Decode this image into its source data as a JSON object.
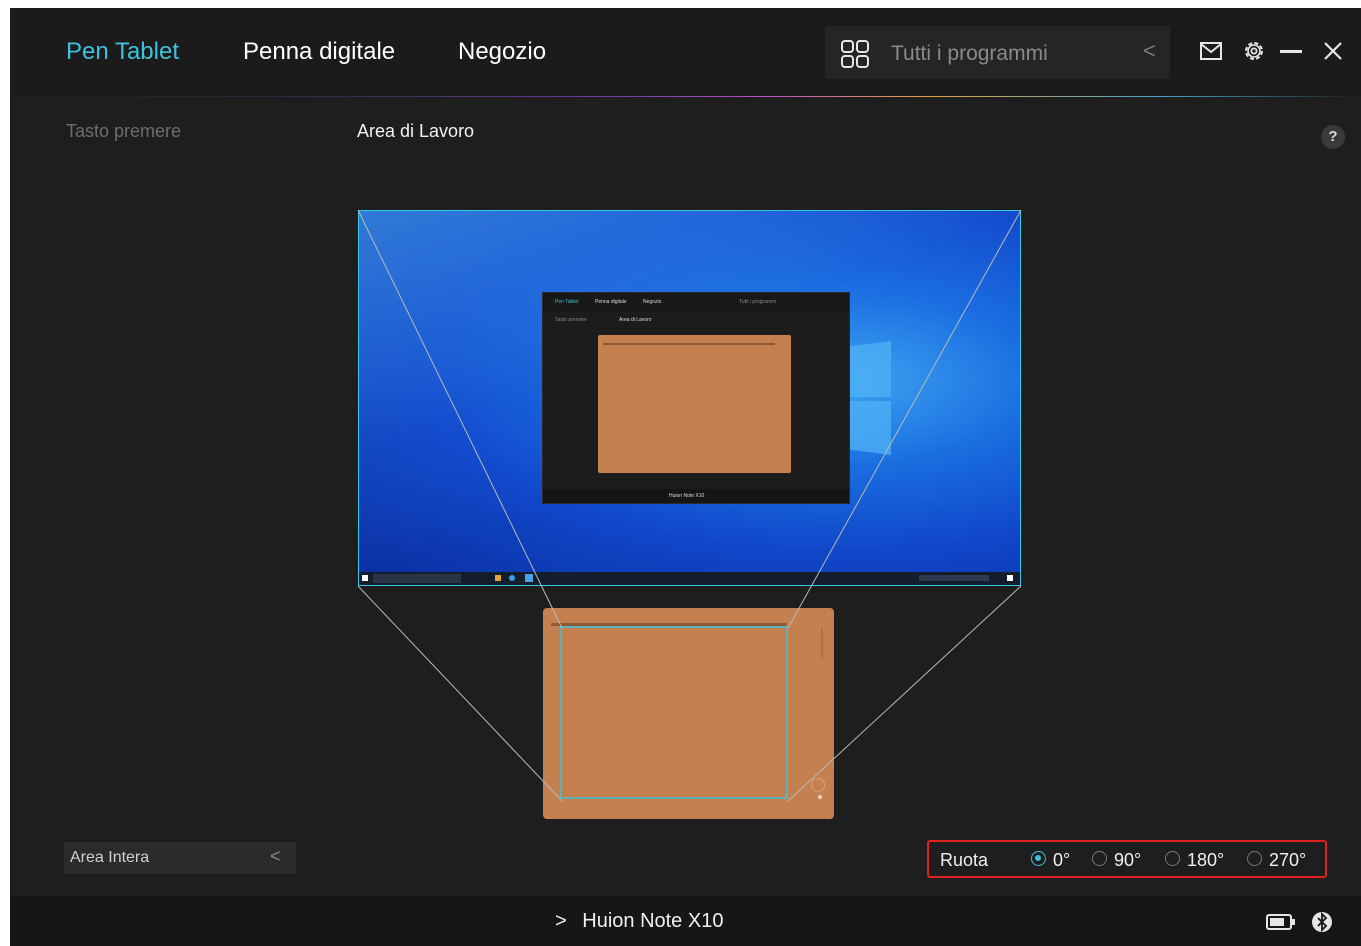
{
  "nav": {
    "tabs": [
      {
        "label": "Pen Tablet",
        "active": true
      },
      {
        "label": "Penna digitale",
        "active": false
      },
      {
        "label": "Negozio",
        "active": false
      }
    ],
    "program_selector": {
      "icon": "grid-icon",
      "label": "Tutti i programmi",
      "chevron": "<"
    },
    "window_icons": [
      "mail-icon",
      "gear-icon",
      "minimize-icon",
      "close-icon"
    ]
  },
  "subheader": {
    "sidebar_item": "Tasto premere",
    "section_title": "Area di Lavoro",
    "help": "?"
  },
  "preview": {
    "mini_app": {
      "tabs": [
        "Pen Tablet",
        "Penna digitale",
        "Negozio"
      ],
      "programs": "Tutti i programmi",
      "sidebar": "Tasto premere",
      "title": "Area di Lavoro",
      "device": "Huion Note X10"
    }
  },
  "area_dropdown": {
    "value": "Area Intera",
    "chevron": "<"
  },
  "rotation": {
    "label": "Ruota",
    "options": [
      "0°",
      "90°",
      "180°",
      "270°"
    ],
    "selected": "0°"
  },
  "footer": {
    "device": "Huion Note X10",
    "chevron": ">"
  },
  "colors": {
    "accent": "#3ec2dc",
    "highlight_box": "#e02020",
    "tablet": "#c4804f",
    "background": "#1e1e1e"
  }
}
